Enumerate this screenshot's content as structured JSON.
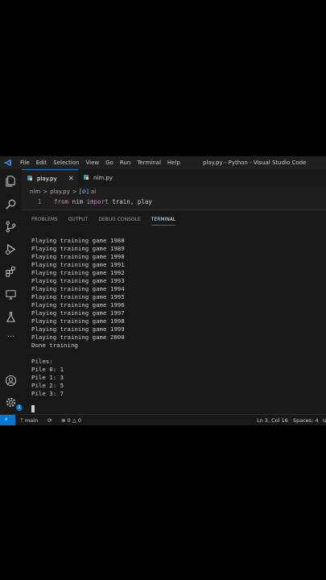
{
  "window": {
    "title": "play.py - Python - Visual Studio Code",
    "menu": [
      "File",
      "Edit",
      "Selection",
      "View",
      "Go",
      "Run",
      "Terminal",
      "Help"
    ]
  },
  "tabs": [
    {
      "label": "play.py",
      "active": true,
      "close": "✕"
    },
    {
      "label": "nim.py",
      "active": false
    }
  ],
  "breadcrumb": [
    "nim",
    ">",
    "play.py",
    ">",
    "ai"
  ],
  "editor": {
    "line_number": "1",
    "code": {
      "kw1": "from",
      "mod": " nim ",
      "kw2": "import",
      "rest": " train, play"
    }
  },
  "panel": {
    "tabs": [
      "PROBLEMS",
      "OUTPUT",
      "DEBUG CONSOLE",
      "TERMINAL"
    ],
    "active_tab": "TERMINAL",
    "terminal_lines": [
      "Playing training game 1988",
      "Playing training game 1989",
      "Playing training game 1990",
      "Playing training game 1991",
      "Playing training game 1992",
      "Playing training game 1993",
      "Playing training game 1994",
      "Playing training game 1995",
      "Playing training game 1996",
      "Playing training game 1997",
      "Playing training game 1998",
      "Playing training game 1999",
      "Playing training game 2000",
      "Done training",
      "",
      "Piles:",
      "Pile 0: 1",
      "Pile 1: 3",
      "Pile 2: 5",
      "Pile 3: 7"
    ]
  },
  "status": {
    "branch": "main",
    "errors": "0",
    "warnings": "0",
    "position": "Ln 3, Col 16",
    "spaces": "Spaces: 4",
    "truncated": "U"
  },
  "accounts_badge": "1",
  "colors": {
    "accent": "#0078d4",
    "keyword": "#c586c0",
    "background": "#1e1e1e"
  }
}
